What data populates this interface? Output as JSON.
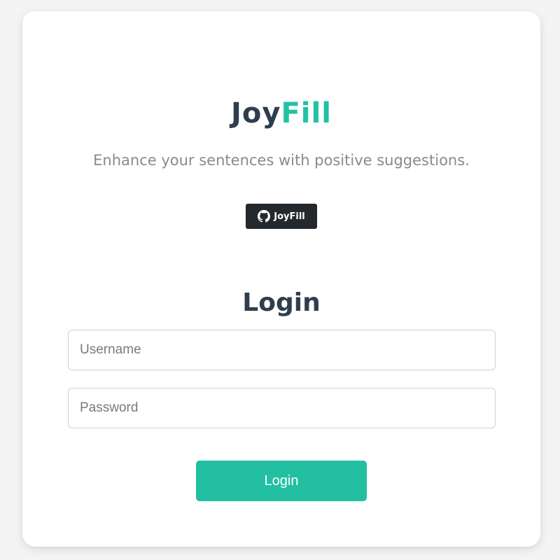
{
  "brand": {
    "part1": "Joy",
    "part2": "Fill",
    "accent_color": "#22c1a4",
    "dark_color": "#2f3e4e"
  },
  "tagline": "Enhance your sentences with positive suggestions.",
  "github_badge": {
    "label": "JoyFill",
    "icon": "github-icon"
  },
  "login_form": {
    "title": "Login",
    "username": {
      "value": "",
      "placeholder": "Username"
    },
    "password": {
      "value": "",
      "placeholder": "Password"
    },
    "submit_label": "Login",
    "submit_color": "#22bfa2"
  }
}
